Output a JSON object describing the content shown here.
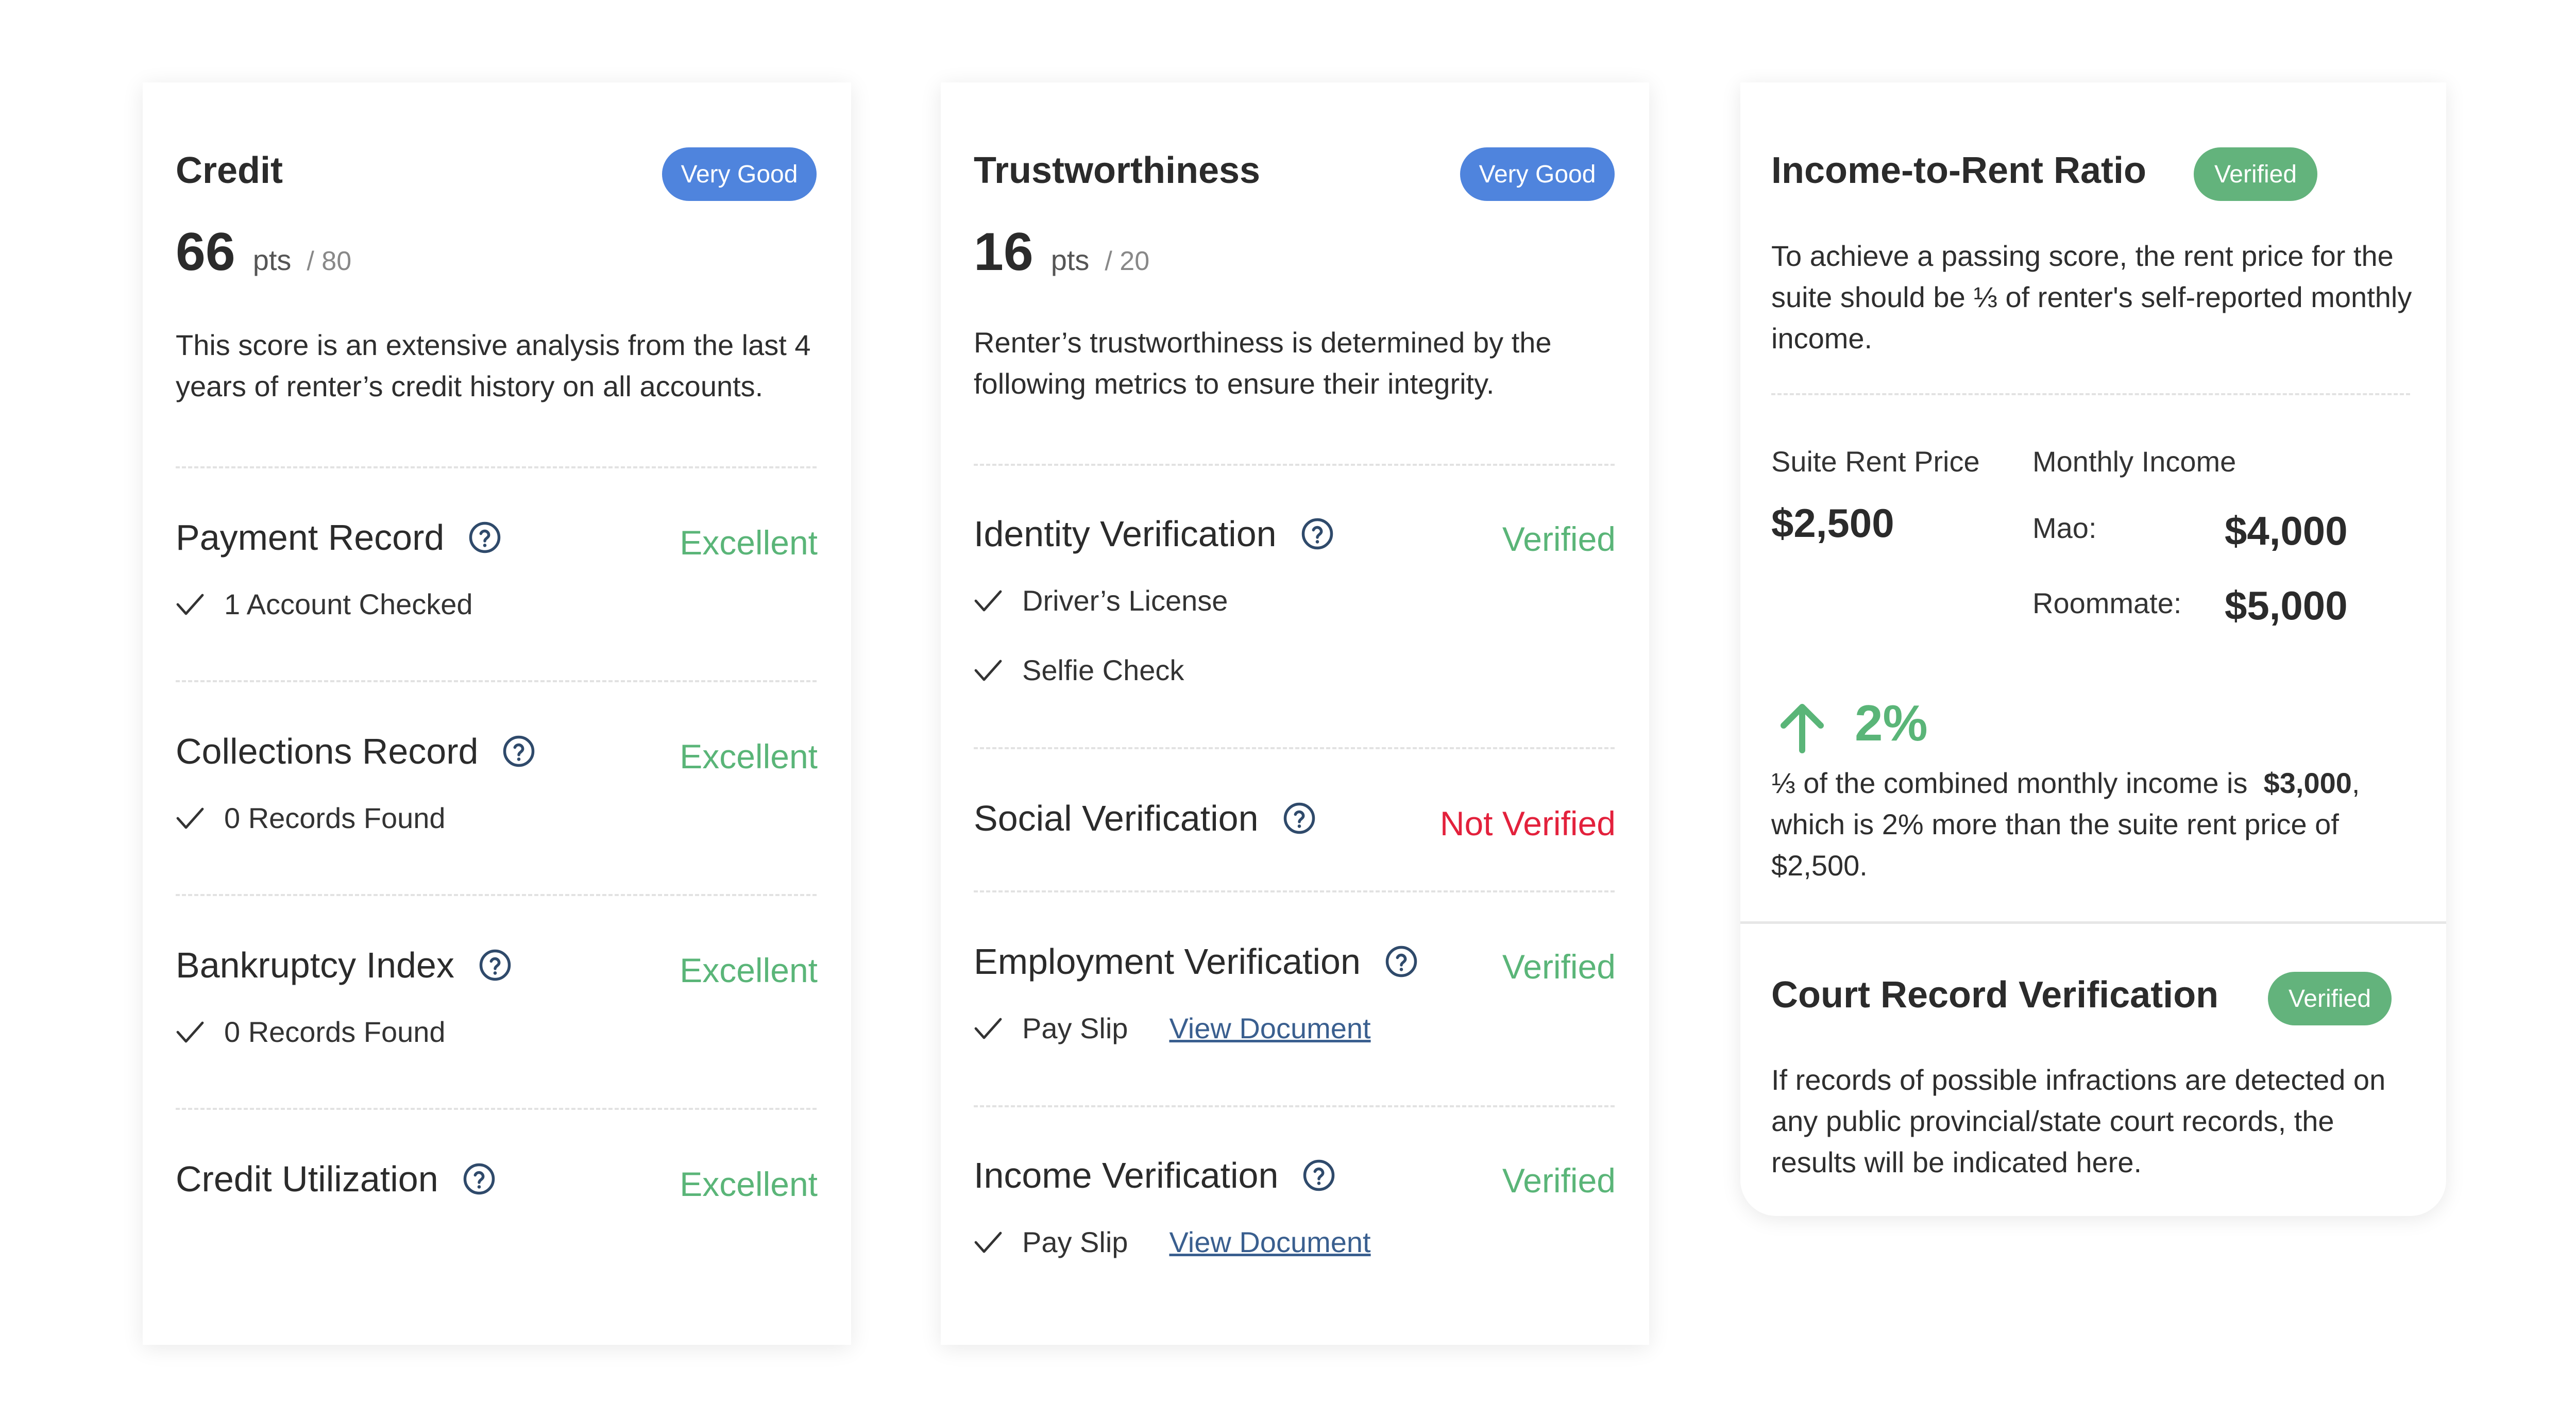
{
  "credit": {
    "title": "Credit",
    "badge": "Very Good",
    "score": "66",
    "unit": "pts",
    "max": "/ 80",
    "description": "This score is an extensive analysis from the last 4 years of renter’s credit history on all accounts.",
    "items": [
      {
        "label": "Payment Record",
        "status": "Excellent",
        "detail": "1 Account Checked"
      },
      {
        "label": "Collections Record",
        "status": "Excellent",
        "detail": "0 Records Found"
      },
      {
        "label": "Bankruptcy Index",
        "status": "Excellent",
        "detail": "0 Records Found"
      },
      {
        "label": "Credit Utilization",
        "status": "Excellent"
      }
    ]
  },
  "trust": {
    "title": "Trustworthiness",
    "badge": "Very Good",
    "score": "16",
    "unit": "pts",
    "max": "/ 20",
    "description": "Renter’s trustworthiness is determined by the following metrics to ensure their integrity.",
    "items": [
      {
        "label": "Identity Verification",
        "status": "Verified",
        "details": [
          "Driver’s License",
          "Selfie Check"
        ]
      },
      {
        "label": "Social Verification",
        "status": "Not Verified"
      },
      {
        "label": "Employment Verification",
        "status": "Verified",
        "details": [
          "Pay Slip"
        ],
        "link": "View Document"
      },
      {
        "label": "Income Verification",
        "status": "Verified",
        "details": [
          "Pay Slip"
        ],
        "link": "View Document"
      }
    ]
  },
  "income": {
    "title": "Income-to-Rent Ratio",
    "badge": "Verified",
    "description": "To achieve a passing score, the rent price for the suite should be ⅓ of renter's self-reported monthly income.",
    "rent_label": "Suite Rent Price",
    "rent_value": "$2,500",
    "monthly_label": "Monthly Income",
    "earners": [
      {
        "name": "Mao:",
        "value": "$4,000"
      },
      {
        "name": "Roommate:",
        "value": "$5,000"
      }
    ],
    "change": "2%",
    "summary_prefix": "⅓ of the combined monthly income is",
    "summary_amount": "$3,000",
    "summary_suffix": ", which is 2% more than the suite rent price of $2,500."
  },
  "court": {
    "title": "Court Record Verification",
    "badge": "Verified",
    "description": "If records of possible infractions are detected on any public provincial/state court records, the results will be indicated here."
  },
  "colors": {
    "blue_badge": "#4f84dd",
    "green_badge": "#63b37c",
    "good": "#5ab578",
    "bad": "#e3213c",
    "link": "#3a5f8f"
  }
}
